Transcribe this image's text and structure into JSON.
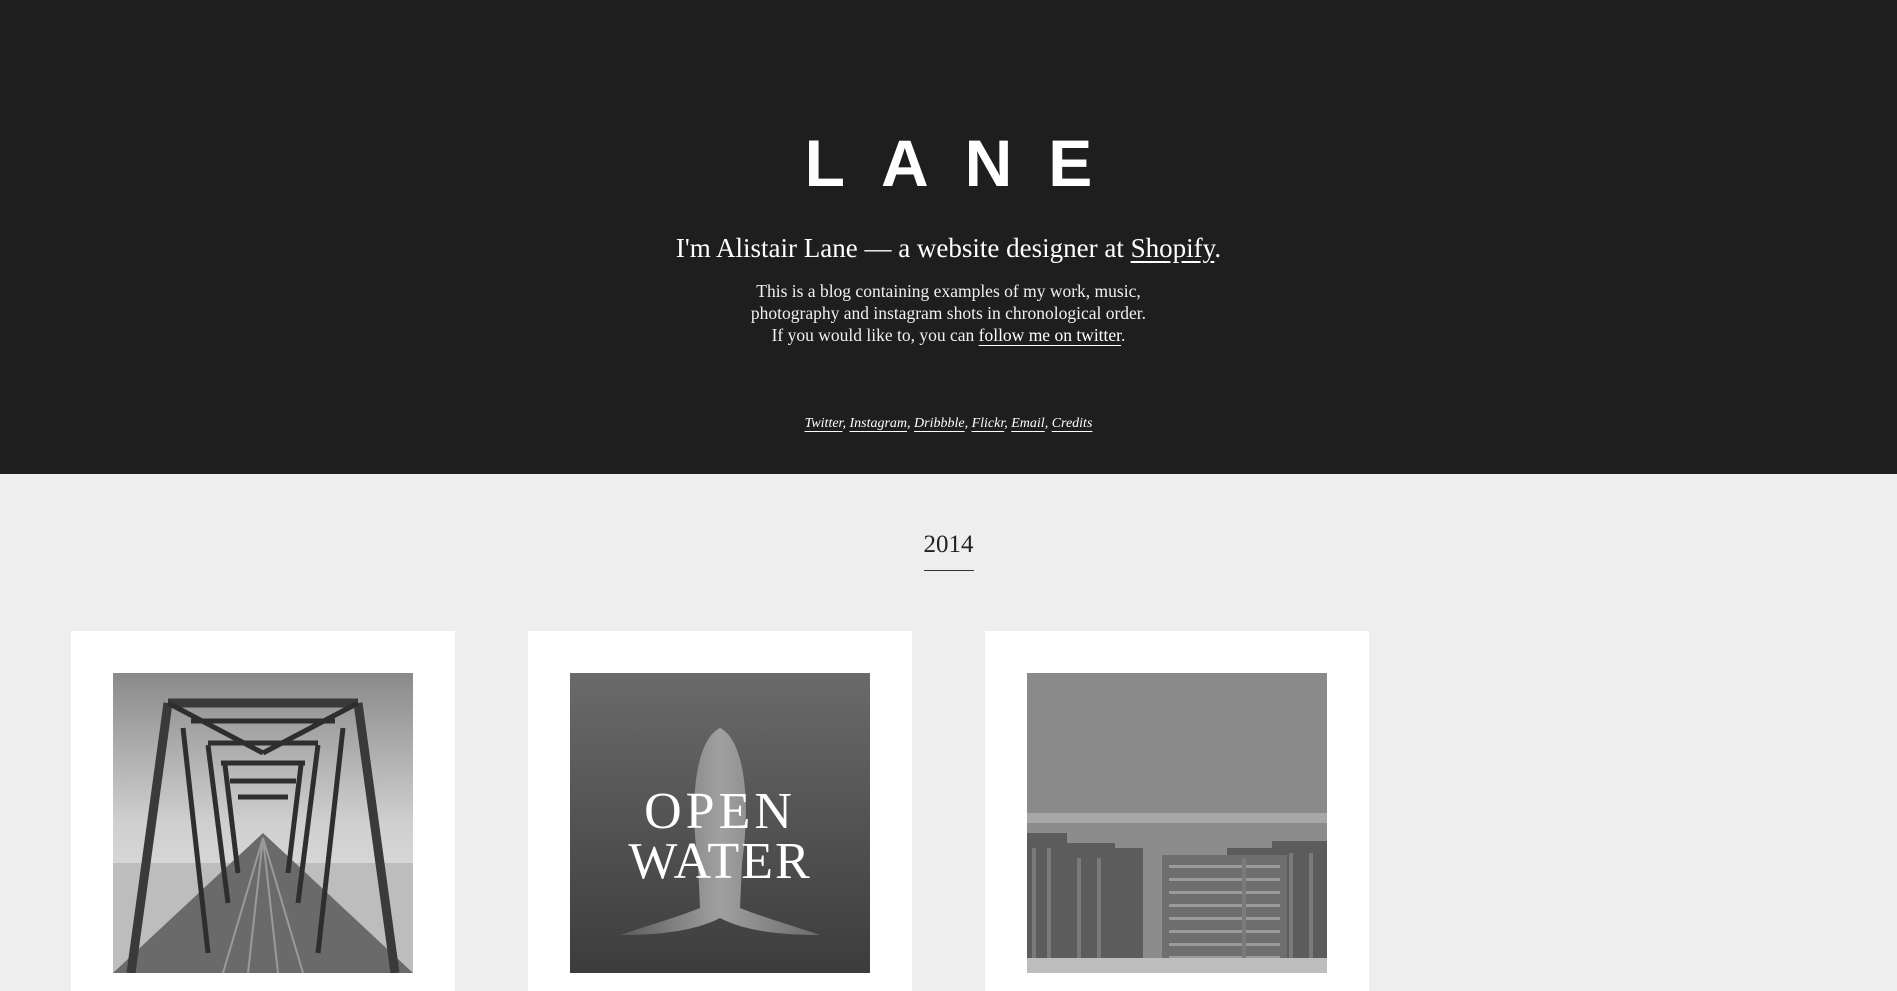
{
  "header": {
    "logo": "LANE",
    "headline_prefix": "I'm Alistair Lane — a website designer at ",
    "headline_link": "Shopify",
    "headline_suffix": ".",
    "intro_line1": "This is a blog containing examples of my work, music,",
    "intro_line2": "photography and instagram shots in chronological order.",
    "intro_line3_prefix": "If you would like to, you can ",
    "intro_link": "follow me on twitter",
    "intro_line3_suffix": ".",
    "social_links": [
      "Twitter",
      "Instagram",
      "Dribbble",
      "Flickr",
      "Email",
      "Credits"
    ]
  },
  "main": {
    "year": "2014",
    "posts": [
      {
        "image": "railway-bridge-photo"
      },
      {
        "image": "open-water-whale-poster",
        "overlay_text_1": "OPEN",
        "overlay_text_2": "WATER"
      },
      {
        "image": "city-skyline-photo"
      }
    ]
  },
  "colors": {
    "header_bg": "#1e1e1e",
    "page_bg": "#eeeeee",
    "card_bg": "#ffffff"
  }
}
